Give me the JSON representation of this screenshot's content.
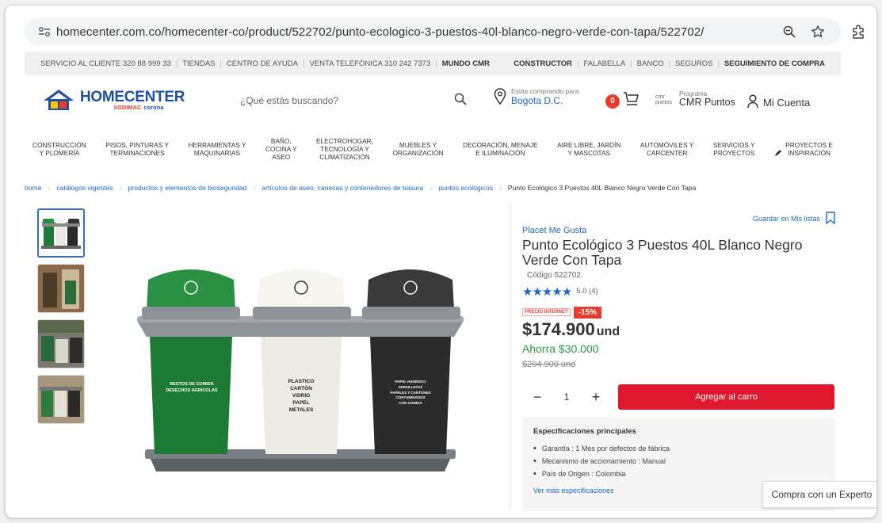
{
  "browser": {
    "url": "homecenter.com.co/homecenter-co/product/522702/punto-ecologico-3-puestos-40l-blanco-negro-verde-con-tapa/522702/"
  },
  "utility_bar": {
    "left": [
      "SERVICIO AL CLIENTE 320 88 999 33",
      "TIENDAS",
      "CENTRO DE AYUDA",
      "VENTA TELEFÓNICA 310 242 7373",
      "MUNDO CMR"
    ],
    "right": [
      "CONSTRUCTOR",
      "FALABELLA",
      "BANCO",
      "SEGUROS",
      "SEGUIMIENTO DE COMPRA"
    ]
  },
  "header": {
    "logo_main": "HOMECENTER",
    "logo_sub_1": "SODIMAC",
    "logo_sub_2": "corona",
    "search_placeholder": "¿Qué estás buscando?",
    "location_label": "Estás comprando para",
    "location_city": "Bogota D.C.",
    "cart_count": "0",
    "cmr_mini": "cmr puntos",
    "cmr_program": "Programa",
    "cmr_name": "CMR Puntos",
    "account": "Mi Cuenta"
  },
  "categories": [
    "CONSTRUCCIÓN\nY PLOMERÍA",
    "PISOS, PINTURAS Y\nTERMINACIONES",
    "HERRAMIENTAS Y\nMAQUINARIAS",
    "BAÑO,\nCOCINA Y\nASEO",
    "ELECTROHOGAR,\nTECNOLOGÍA Y\nCLIMATIZACIÓN",
    "MUEBLES Y\nORGANIZACIÓN",
    "DECORACIÓN, MENAJE\nE ILUMINACIÓN",
    "AIRE LIBRE, JARDÍN\nY MASCOTAS",
    "AUTOMÓVILES Y\nCARCENTER",
    "SERVICIOS Y\nPROYECTOS",
    "PROYECTOS E\nINSPIRACIÓN"
  ],
  "breadcrumb": [
    "home",
    "catálogos vigentes",
    "productos y elementos de bioseguridad",
    "artículos de aseo, canecas y contenedores de basura",
    "puntos ecológicos",
    "Punto Ecológico 3 Puestos 40L Blanco Negro Verde Con Tapa"
  ],
  "product": {
    "save_list": "Guardar en Mis listas",
    "brand": "Placet Me Gusta",
    "title": "Punto Ecológico 3 Puestos 40L Blanco Negro Verde Con Tapa",
    "code": "Código 522702",
    "stars": "★★★★★",
    "rating_value": 5.0,
    "rating_text": "5.0 (4)",
    "promo_label": "PRECIO INTERNET",
    "discount": "-15%",
    "price": "$174.900",
    "price_unit": "und",
    "savings": "Ahorra $30.000",
    "old_price": "$204.900 und",
    "quantity": "1",
    "minus": "−",
    "plus": "+",
    "add_to_cart": "Agregar al carro"
  },
  "bins": {
    "green_label": "RESTOS DE COMIDA\nDESECHOS AGRICOLAS",
    "white_label": "PLASTICO\nCARTÓN\nVIDRIO\nPAPEL\nMETALES",
    "black_label": "PAPEL HIGIÉNICO\nSERVILLETAS\nPAPELES Y CARTONES\nCONTAMINADOS\nCON COMIDA"
  },
  "specs": {
    "title": "Especificaciones principales",
    "items": [
      "Garantía : 1 Mes por defectos de fábrica",
      "Mecanismo de accionamiento : Manual",
      "País de Origen : Colombia"
    ],
    "more": "Ver más especificaciones"
  },
  "expert_button": "Compra con un Experto",
  "colors": {
    "brand_blue": "#1f4fa3",
    "link_blue": "#1f67c2",
    "red": "#e0182d",
    "green": "#2d9a3c"
  }
}
